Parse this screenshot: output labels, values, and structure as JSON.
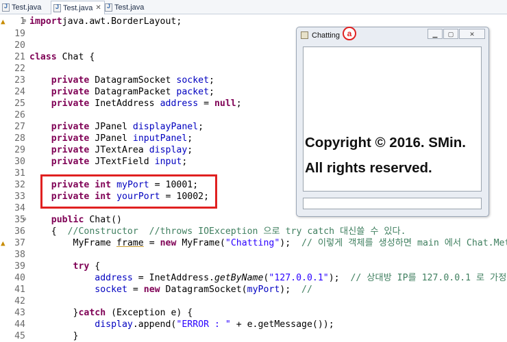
{
  "tabs": [
    {
      "label": "Test.java",
      "active": false
    },
    {
      "label": "Test.java",
      "active": true
    },
    {
      "label": "Test.java",
      "active": false
    }
  ],
  "code": [
    {
      "n": "1",
      "s": [
        [
          "kw",
          "import"
        ],
        [
          "",
          "java.awt.BorderLayout;"
        ]
      ]
    },
    {
      "n": "19",
      "s": []
    },
    {
      "n": "20",
      "s": []
    },
    {
      "n": "21",
      "s": [
        [
          "kw",
          "class"
        ],
        [
          "",
          " Chat {"
        ]
      ]
    },
    {
      "n": "22",
      "s": []
    },
    {
      "n": "23",
      "s": [
        [
          "",
          "    "
        ],
        [
          "kw",
          "private"
        ],
        [
          "",
          " DatagramSocket "
        ],
        [
          "fld",
          "socket"
        ],
        [
          "",
          ";"
        ]
      ]
    },
    {
      "n": "24",
      "s": [
        [
          "",
          "    "
        ],
        [
          "kw",
          "private"
        ],
        [
          "",
          " DatagramPacket "
        ],
        [
          "fld",
          "packet"
        ],
        [
          "",
          ";"
        ]
      ]
    },
    {
      "n": "25",
      "s": [
        [
          "",
          "    "
        ],
        [
          "kw",
          "private"
        ],
        [
          "",
          " InetAddress "
        ],
        [
          "fld",
          "address"
        ],
        [
          "",
          " = "
        ],
        [
          "kw",
          "null"
        ],
        [
          "",
          ";"
        ]
      ]
    },
    {
      "n": "26",
      "s": []
    },
    {
      "n": "27",
      "s": [
        [
          "",
          "    "
        ],
        [
          "kw",
          "private"
        ],
        [
          "",
          " JPanel "
        ],
        [
          "fld",
          "displayPanel"
        ],
        [
          "",
          ";"
        ]
      ]
    },
    {
      "n": "28",
      "s": [
        [
          "",
          "    "
        ],
        [
          "kw",
          "private"
        ],
        [
          "",
          " JPanel "
        ],
        [
          "fld",
          "inputPanel"
        ],
        [
          "",
          ";"
        ]
      ]
    },
    {
      "n": "29",
      "s": [
        [
          "",
          "    "
        ],
        [
          "kw",
          "private"
        ],
        [
          "",
          " JTextArea "
        ],
        [
          "fld",
          "display"
        ],
        [
          "",
          ";"
        ]
      ]
    },
    {
      "n": "30",
      "s": [
        [
          "",
          "    "
        ],
        [
          "kw",
          "private"
        ],
        [
          "",
          " JTextField "
        ],
        [
          "fld",
          "input"
        ],
        [
          "",
          ";"
        ]
      ]
    },
    {
      "n": "31",
      "s": []
    },
    {
      "n": "32",
      "s": [
        [
          "",
          "    "
        ],
        [
          "kw",
          "private"
        ],
        [
          "kw",
          " int"
        ],
        [
          "",
          " "
        ],
        [
          "fld",
          "myPort"
        ],
        [
          "",
          " = 10001;"
        ]
      ]
    },
    {
      "n": "33",
      "s": [
        [
          "",
          "    "
        ],
        [
          "kw",
          "private"
        ],
        [
          "kw",
          " int"
        ],
        [
          "",
          " "
        ],
        [
          "fld",
          "yourPort"
        ],
        [
          "",
          " = 10002;"
        ]
      ]
    },
    {
      "n": "34",
      "s": []
    },
    {
      "n": "35",
      "s": [
        [
          "",
          "    "
        ],
        [
          "kw",
          "public"
        ],
        [
          "",
          " Chat()"
        ]
      ]
    },
    {
      "n": "36",
      "s": [
        [
          "",
          "    {  "
        ],
        [
          "cmt",
          "//Constructor  //throws IOException 으로 try catch 대신쓸 수 있다."
        ]
      ]
    },
    {
      "n": "37",
      "s": [
        [
          "",
          "        MyFrame "
        ],
        [
          "und",
          "frame"
        ],
        [
          "",
          " = "
        ],
        [
          "kw",
          "new"
        ],
        [
          "",
          " MyFrame("
        ],
        [
          "str",
          "\"Chatting\""
        ],
        [
          "",
          ");  "
        ],
        [
          "cmt",
          "// 이렇게 객체를 생성하면 main 에서 Chat.Meth"
        ]
      ]
    },
    {
      "n": "38",
      "s": []
    },
    {
      "n": "39",
      "s": [
        [
          "",
          "        "
        ],
        [
          "kw",
          "try"
        ],
        [
          "",
          " {"
        ]
      ]
    },
    {
      "n": "40",
      "s": [
        [
          "",
          "            "
        ],
        [
          "fld",
          "address"
        ],
        [
          "",
          " = InetAddress."
        ],
        [
          "it",
          "getByName"
        ],
        [
          "",
          "("
        ],
        [
          "str",
          "\"127.0.0.1\""
        ],
        [
          "",
          ");  "
        ],
        [
          "cmt",
          "// 상대방 IP를 127.0.0.1 로 가정."
        ]
      ]
    },
    {
      "n": "41",
      "s": [
        [
          "",
          "            "
        ],
        [
          "fld",
          "socket"
        ],
        [
          "",
          " = "
        ],
        [
          "kw",
          "new"
        ],
        [
          "",
          " DatagramSocket("
        ],
        [
          "fld",
          "myPort"
        ],
        [
          "",
          ");  "
        ],
        [
          "cmt",
          "//"
        ]
      ]
    },
    {
      "n": "42",
      "s": []
    },
    {
      "n": "43",
      "s": [
        [
          "",
          "        }"
        ],
        [
          "kw",
          "catch"
        ],
        [
          "",
          " (Exception e) {"
        ]
      ]
    },
    {
      "n": "44",
      "s": [
        [
          "",
          "            "
        ],
        [
          "fld",
          "display"
        ],
        [
          "",
          ".append("
        ],
        [
          "str",
          "\"ERROR : \""
        ],
        [
          "",
          " + e.getMessage());"
        ]
      ]
    },
    {
      "n": "45",
      "s": [
        [
          "",
          "        }"
        ]
      ]
    }
  ],
  "chat_window": {
    "title": "Chatting",
    "badge": "a",
    "copyright_line1": "Copyright © 2016. SMin.",
    "copyright_line2": "All rights reserved."
  }
}
